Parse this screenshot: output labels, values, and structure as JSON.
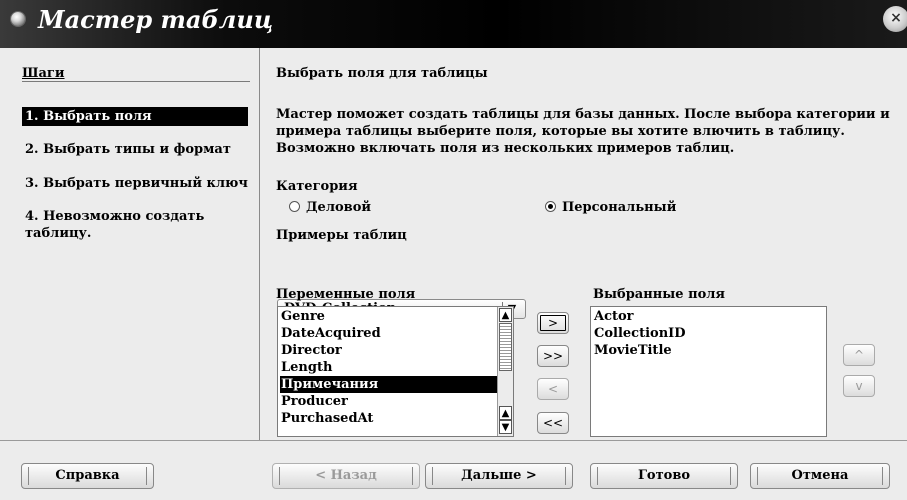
{
  "window": {
    "title": "Мастер таблиц",
    "close_glyph": "×"
  },
  "sidebar": {
    "title": "Шаги",
    "steps": [
      {
        "label": "1. Выбрать поля",
        "active": true
      },
      {
        "label": "2. Выбрать типы и формат",
        "active": false
      },
      {
        "label": "3. Выбрать первичный ключ",
        "active": false
      },
      {
        "label": "4. Невозможно создать таблицу.",
        "active": false
      }
    ]
  },
  "main": {
    "title": "Выбрать поля для таблицы",
    "description": "Мастер поможет создать таблицы для базы данных. После выбора категории и примера таблицы выберите поля, которые вы хотите влючить в таблицу. Возможно включать поля из нескольких примеров таблиц.",
    "category_label": "Категория",
    "radios": [
      {
        "label": "Деловой",
        "checked": false
      },
      {
        "label": "Персональный",
        "checked": true
      }
    ],
    "samples_label": "Примеры таблиц",
    "samples_value": "DVD-Collection",
    "available_label": "Переменные поля",
    "available_fields": [
      "Genre",
      "DateAcquired",
      "Director",
      "Length",
      "Примечания",
      "Producer",
      "PurchasedAt"
    ],
    "available_selected_index": 4,
    "selected_label": "Выбранные поля",
    "selected_fields": [
      "Actor",
      "CollectionID",
      "MovieTitle"
    ],
    "move_buttons": [
      ">",
      ">>",
      "<",
      "<<"
    ],
    "order_buttons": [
      "^",
      "v"
    ],
    "scroll_up": "▲",
    "scroll_down": "▼"
  },
  "footer": {
    "help": "Справка",
    "back": "< Назад",
    "next": "Дальше >",
    "finish": "Готово",
    "cancel": "Отмена"
  },
  "colors": {
    "titlebar": "#000000",
    "selection": "#000000",
    "background": "#ececec"
  }
}
